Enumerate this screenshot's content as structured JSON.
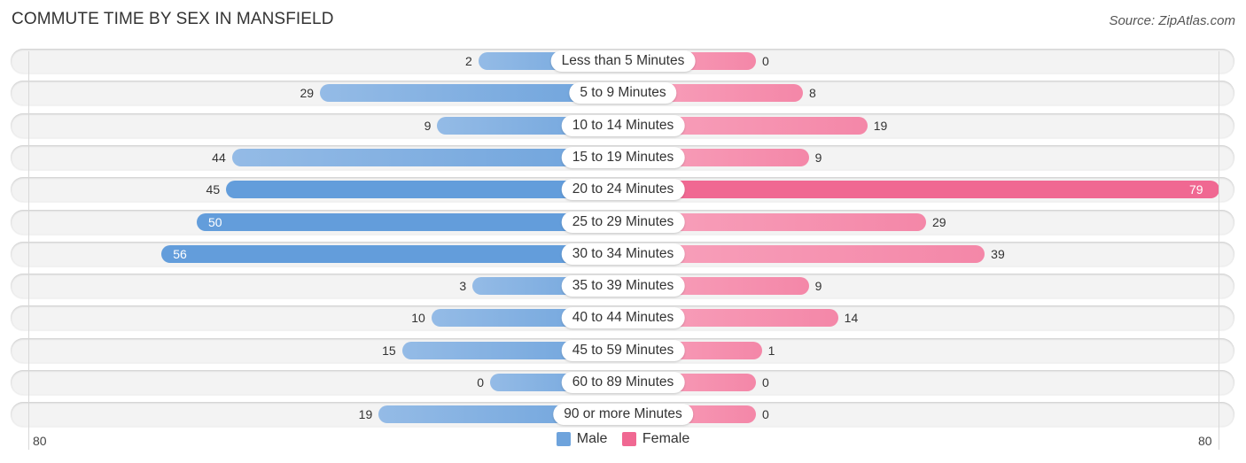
{
  "header": {
    "title": "COMMUTE TIME BY SEX IN MANSFIELD",
    "source": "Source: ZipAtlas.com"
  },
  "colors": {
    "male": "#6ea3dc",
    "female": "#f06892"
  },
  "chart_data": {
    "type": "bar",
    "orientation": "horizontal-diverging",
    "title": "COMMUTE TIME BY SEX IN MANSFIELD",
    "categories": [
      "Less than 5 Minutes",
      "5 to 9 Minutes",
      "10 to 14 Minutes",
      "15 to 19 Minutes",
      "20 to 24 Minutes",
      "25 to 29 Minutes",
      "30 to 34 Minutes",
      "35 to 39 Minutes",
      "40 to 44 Minutes",
      "45 to 59 Minutes",
      "60 to 89 Minutes",
      "90 or more Minutes"
    ],
    "series": [
      {
        "name": "Male",
        "values": [
          2,
          29,
          9,
          44,
          45,
          50,
          56,
          3,
          10,
          15,
          0,
          19
        ]
      },
      {
        "name": "Female",
        "values": [
          0,
          8,
          19,
          9,
          79,
          29,
          39,
          9,
          14,
          1,
          0,
          0
        ]
      }
    ],
    "axis": {
      "left_label": "80",
      "right_label": "80",
      "max": 80
    },
    "legend": {
      "position": "bottom-center",
      "entries": [
        "Male",
        "Female"
      ]
    },
    "grid": false
  }
}
